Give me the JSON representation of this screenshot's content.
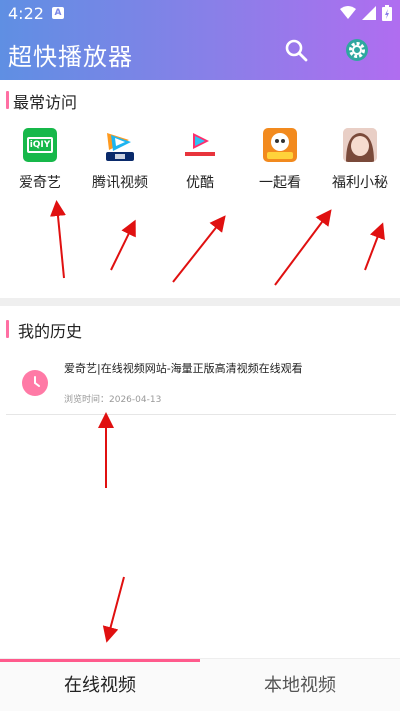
{
  "status_bar": {
    "time": "4:22",
    "notification_letter": "A"
  },
  "header": {
    "title": "超快播放器",
    "search_icon": "search-icon",
    "settings_icon": "settings-icon"
  },
  "frequent": {
    "title": "最常访问",
    "items": [
      {
        "label": "爱奇艺",
        "icon": "iqiyi-icon"
      },
      {
        "label": "腾讯视频",
        "icon": "tencent-video-icon"
      },
      {
        "label": "优酷",
        "icon": "youku-icon"
      },
      {
        "label": "一起看",
        "icon": "douyu-icon"
      },
      {
        "label": "福利小秘",
        "icon": "avatar-icon"
      }
    ]
  },
  "history": {
    "title": "我的历史",
    "items": [
      {
        "title": "爱奇艺|在线视频网站-海量正版高清视频在线观看",
        "date": "浏览时间：2026-04-13"
      }
    ]
  },
  "bottom_nav": {
    "tabs": [
      {
        "label": "在线视频",
        "active": true
      },
      {
        "label": "本地视频",
        "active": false
      }
    ]
  },
  "colors": {
    "accent": "#ff5a8c",
    "header_start": "#5f8fe3",
    "header_end": "#b06df0"
  }
}
